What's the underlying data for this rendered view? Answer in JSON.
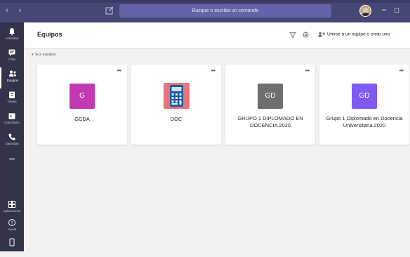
{
  "titlebar": {
    "search_placeholder": "Busque o escriba un comando"
  },
  "rail": {
    "items": [
      {
        "label": "Actividad",
        "icon": "bell-icon"
      },
      {
        "label": "Chat",
        "icon": "chat-icon"
      },
      {
        "label": "Equipos",
        "icon": "teams-icon",
        "active": true
      },
      {
        "label": "Tareas",
        "icon": "assignments-icon"
      },
      {
        "label": "Calendario",
        "icon": "calendar-icon"
      },
      {
        "label": "Llamadas",
        "icon": "phone-icon"
      },
      {
        "label": "•••",
        "icon": "more-icon"
      },
      {
        "label": "Aplicaciones",
        "icon": "apps-icon"
      },
      {
        "label": "Ayuda",
        "icon": "help-icon"
      }
    ]
  },
  "header": {
    "title": "Equipos",
    "join_label": "Unirse a un equipo o crear uno"
  },
  "section": {
    "label": "Sus equipos"
  },
  "cards": [
    {
      "tile_text": "G",
      "name": "GCDA",
      "color": "#c239b3",
      "more": "•••"
    },
    {
      "tile_text": "",
      "name": "DOC",
      "color": "#e8747c",
      "icon": "calculator-icon",
      "more": "•••"
    },
    {
      "tile_text": "GD",
      "name": "GRUPO 1 DIPLOMADO EN DOCENCIA 2020",
      "color": "#6e6e6e",
      "more": "•••"
    },
    {
      "tile_text": "GD",
      "name": "Grupo 1   Diplomado en Docencia Universitaria 2020",
      "color": "#7f5af0",
      "more": "•••"
    }
  ],
  "colors": {
    "titlebar": "#464775",
    "rail": "#33344a",
    "search": "#6264a7"
  }
}
